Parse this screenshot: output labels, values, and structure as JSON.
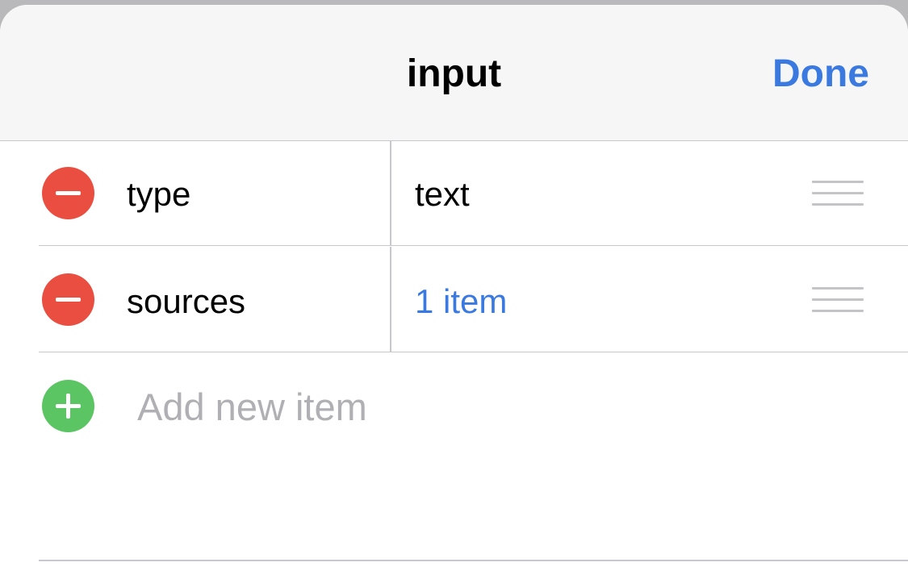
{
  "navbar": {
    "title": "input",
    "done_label": "Done"
  },
  "rows": [
    {
      "key": "type",
      "value": "text",
      "value_style": "plain",
      "remove_icon": "minus-circle-icon",
      "handle_icon": "drag-handle-icon"
    },
    {
      "key": "sources",
      "value": "1 item",
      "value_style": "link",
      "remove_icon": "minus-circle-icon",
      "handle_icon": "drag-handle-icon"
    }
  ],
  "add_row": {
    "label": "Add new item",
    "icon": "plus-circle-icon"
  },
  "colors": {
    "accent": "#3a7ae0",
    "remove": "#e94e40",
    "add": "#5bc563",
    "placeholder": "#b0b0b4"
  }
}
